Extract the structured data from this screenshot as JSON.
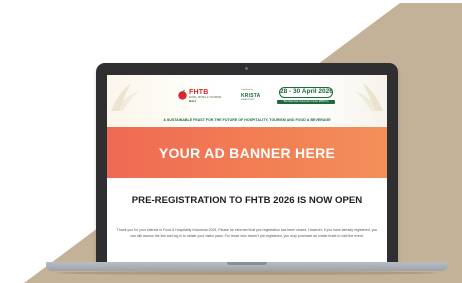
{
  "colors": {
    "background": "#ffffff",
    "decor_shape": "#c4b298",
    "laptop_bezel": "#2f2f31",
    "laptop_base": "#b8bcc2",
    "brand_red": "#d6262e",
    "brand_green": "#1d6a3d",
    "banner": "#f27e53"
  },
  "header": {
    "fhtb_name": "FHTB",
    "fhtb_subtitle": "FOOD, HOTEL & TOURISM",
    "fhtb_location": "BALI",
    "organiser_label": "Organised by",
    "organiser_logo": "KRISTA",
    "organiser_sub": "EXHIBITIONS",
    "date": "28 - 30 April 2026",
    "venue": "Bali Nusa Dua Convention Center (BNDCC)",
    "tagline": "A SUSTAINABLE FEAST FOR THE FUTURE OF HOSPITALITY, TOURISM AND FOOD & BEVERAGE"
  },
  "ad_banner": {
    "text": "YOUR AD BANNER HERE"
  },
  "main": {
    "title": "PRE-REGISTRATION TO FHTB 2026 IS NOW OPEN",
    "body": "Thank you for your interest in Food & Hospitality Indonesia 2024. Please be informed that pre-registration has been closed. However, if you have already registered, you can still access the link and log in to obtain your visitor pass. For those who haven't pre-registered, you may purchase an onsite ticket to visit the event."
  },
  "icons": {
    "logo": "apple-icon",
    "decoration_left": "palm-leaf-icon",
    "decoration_right": "palm-leaf-icon",
    "camera": "camera-dot-icon"
  }
}
